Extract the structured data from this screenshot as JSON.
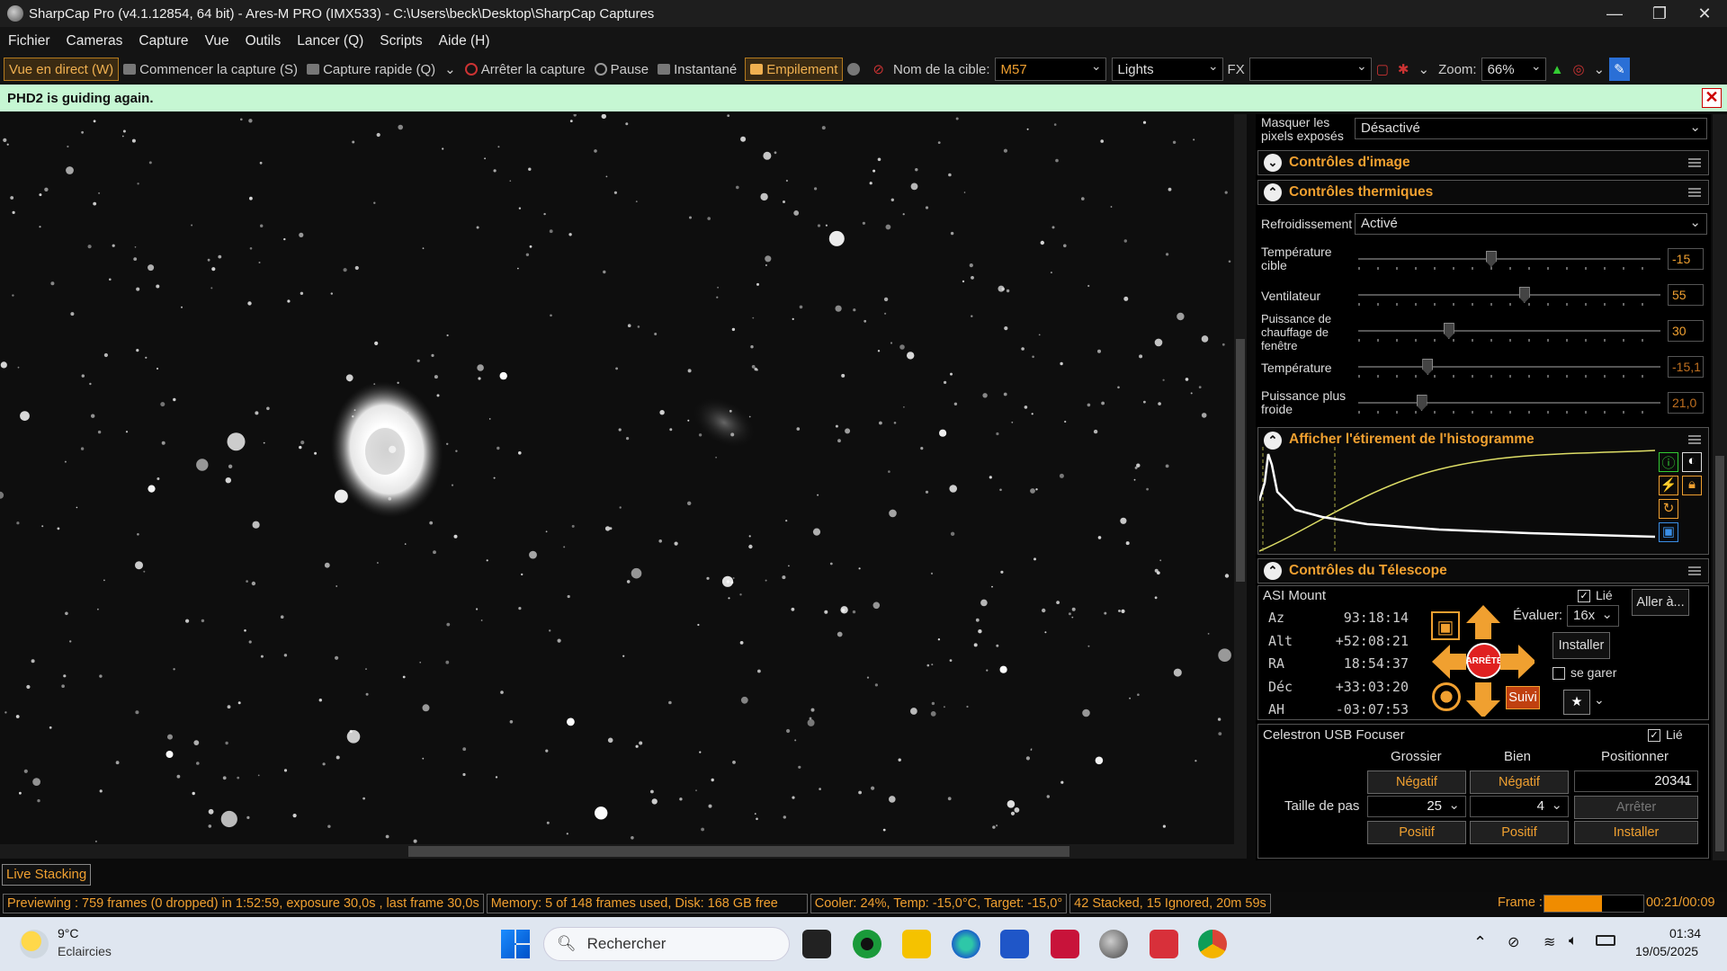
{
  "window": {
    "title": "SharpCap Pro (v4.1.12854, 64 bit) - Ares-M PRO (IMX533) - C:\\Users\\beck\\Desktop\\SharpCap Captures",
    "minimize": "—",
    "maximize": "❐",
    "close": "✕"
  },
  "menu": [
    "Fichier",
    "Cameras",
    "Capture",
    "Vue",
    "Outils",
    "Lancer (Q)",
    "Scripts",
    "Aide (H)"
  ],
  "toolbar": {
    "live": "Vue en direct (W)",
    "start_capture": "Commencer la capture (S)",
    "quick_capture": "Capture rapide (Q)",
    "stop_capture": "Arrêter la capture",
    "pause": "Pause",
    "snapshot": "Instantané",
    "stacking": "Empilement",
    "target_label": "Nom de la cible:",
    "target_value": "M57",
    "frame_type": "Lights",
    "fx_label": "FX",
    "fx_value": "",
    "zoom_label": "Zoom:",
    "zoom_value": "66%"
  },
  "notification": {
    "text": "PHD2 is guiding again.",
    "close": "✕"
  },
  "panel": {
    "mask_label_1": "Masquer les",
    "mask_label_2": "pixels exposés",
    "mask_value": "Désactivé",
    "image_controls": "Contrôles d'image",
    "thermal_controls": "Contrôles thermiques",
    "cooling_label": "Refroidissement",
    "cooling_value": "Activé",
    "sliders": [
      {
        "label1": "Température",
        "label2": "cible",
        "value": "-15",
        "level": 0.44
      },
      {
        "label1": "Ventilateur",
        "label2": "",
        "value": "55",
        "level": 0.55
      },
      {
        "label1": "Puissance de",
        "label2": "chauffage de",
        "label3": "fenêtre",
        "value": "30",
        "level": 0.3
      },
      {
        "label1": "Température",
        "label2": "",
        "value": "-15,1",
        "level": 0.23
      },
      {
        "label1": "Puissance plus",
        "label2": "froide",
        "value": "21,0",
        "level": 0.21
      }
    ],
    "histogram_title": "Afficher l'étirement de l'histogramme",
    "telescope_title": "Contrôles du Télescope",
    "mount": {
      "name": "ASI Mount",
      "linked": "Lié",
      "goto": "Aller à...",
      "rate_label": "Évaluer:",
      "rate_value": "16x",
      "install": "Installer",
      "park": "se garer",
      "stop": "ARRÊTE",
      "tracking": "Suivi",
      "coords": [
        {
          "k": "Az",
          "v": "93:18:14"
        },
        {
          "k": "Alt",
          "v": "+52:08:21"
        },
        {
          "k": "RA",
          "v": "18:54:37"
        },
        {
          "k": "Déc",
          "v": "+33:03:20"
        },
        {
          "k": "AH",
          "v": "-03:07:53"
        }
      ]
    },
    "focuser": {
      "name": "Celestron USB Focuser",
      "linked": "Lié",
      "coarse": "Grossier",
      "fine": "Bien",
      "position_label": "Positionner",
      "negative": "Négatif",
      "positive": "Positif",
      "step_label": "Taille de pas",
      "coarse_step": "25",
      "fine_step": "4",
      "position": "20341",
      "stop": "Arrêter",
      "install": "Installer"
    }
  },
  "live_stacking_tab": "Live Stacking",
  "status": {
    "preview": "Previewing : 759 frames (0 dropped) in 1:52:59, exposure 30,0s , last frame 30,0s",
    "memory": "Memory: 5 of 148 frames used, Disk: 168 GB free",
    "cooler": "Cooler: 24%, Temp: -15,0°C, Target: -15,0°",
    "stacked": "42 Stacked, 15 Ignored, 20m 59s",
    "frame_label": "Frame :",
    "frame_progress": 0.58,
    "frame_time": "00:21/00:09"
  },
  "taskbar": {
    "temp": "9°C",
    "weather": "Eclaircies",
    "search": "Rechercher",
    "time": "01:34",
    "date": "19/05/2025"
  },
  "colors": {
    "accent": "#f0a030",
    "notification": "#c6f7d3",
    "background": "#000000"
  }
}
